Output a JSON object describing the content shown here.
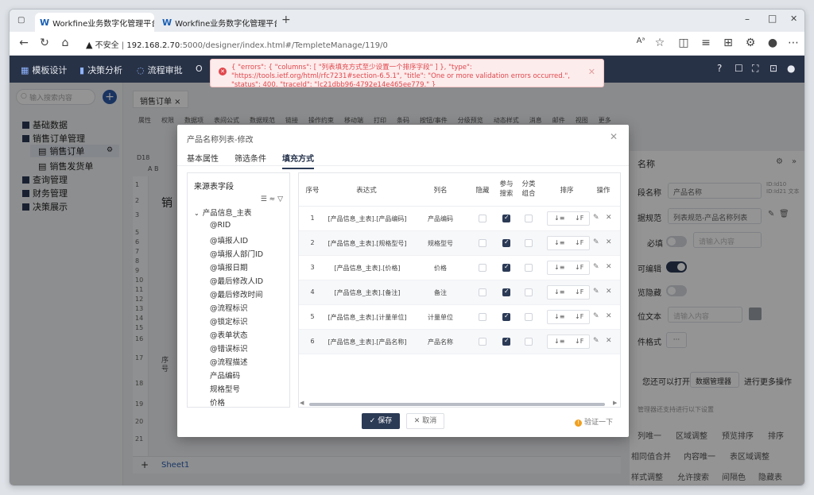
{
  "browser": {
    "tabs": [
      {
        "label": "Workfine业务数字化管理平台-II"
      },
      {
        "label": "Workfine业务数字化管理平台"
      }
    ],
    "new_tab": "+",
    "security_label": "不安全",
    "url_host": "192.168.2.70",
    "url_path": ":5000/designer/index.html#/TempleteManage/119/0",
    "window_controls": {
      "minimize": "–",
      "maximize": "□",
      "close": "✕"
    },
    "toolbar_icons": [
      "read-aloud-icon",
      "favorite-icon",
      "split-icon",
      "favorites-bar-icon",
      "collections-icon",
      "extensions-icon",
      "profile-icon",
      "more-icon"
    ]
  },
  "app": {
    "nav": [
      {
        "label": "模板设计"
      },
      {
        "label": "决策分析"
      },
      {
        "label": "流程审批"
      },
      {
        "label": "O"
      }
    ],
    "header_icons": [
      "?",
      "☐",
      "⛶",
      "⊡",
      "●"
    ]
  },
  "error_toast": {
    "message": "{ \"errors\": { \"columns\": [ \"列表填充方式至少设置一个排序字段\" ] }, \"type\": \"https://tools.ietf.org/html/rfc7231#section-6.5.1\", \"title\": \"One or more validation errors occurred.\", \"status\": 400, \"traceId\": \"|c21dbb96-4792e14e465ee779.\" }",
    "close": "✕"
  },
  "sidebar": {
    "search_placeholder": "输入搜索内容",
    "add": "+",
    "items": [
      {
        "label": "基础数据"
      },
      {
        "label": "销售订单管理"
      },
      {
        "label": "销售订单"
      },
      {
        "label": "销售发货单"
      },
      {
        "label": "查询管理"
      },
      {
        "label": "财务管理"
      },
      {
        "label": "决策展示"
      }
    ]
  },
  "workspace": {
    "page_tab": "销售订单 ×",
    "toolbar": [
      "属性",
      "权限",
      "数据项",
      "表间公式",
      "数据规范",
      "链接",
      "操作约束",
      "移动端",
      "打印",
      "条码",
      "按钮/事件",
      "分级预览",
      "动态样式",
      "消息",
      "邮件",
      "视图",
      "更多"
    ],
    "cell_ref": "D18",
    "col_labels": "A B",
    "row_numbers": [
      "1",
      "2",
      "3",
      "5",
      "6",
      "7",
      "8",
      "9",
      "10",
      "11",
      "12",
      "13",
      "14",
      "15",
      "16",
      "17",
      "18",
      "19",
      "20",
      "21"
    ],
    "cell_text_1": "销",
    "cell_text_2": "序号",
    "sheet_add": "+",
    "sheet_name": "Sheet1"
  },
  "right_panel": {
    "header": "名称",
    "field_name_label": "段名称",
    "field_name_value": "产品名称",
    "field_meta": "ID:Id10 ID:Id21 文本",
    "data_rule_label": "据规范",
    "data_rule_value": "列表规范-产品名称列表",
    "required_label": "必填",
    "required_placeholder": "请输入内容",
    "editable_label": "可编辑",
    "hidden_label": "览隐藏",
    "tip_label": "位文本",
    "tip_placeholder": "请输入内容",
    "format_label": "件格式",
    "format_btn": "···",
    "open_prompt": "您还可以打开",
    "data_manager": "数据管理器",
    "more_ops": "进行更多操作",
    "hint": "管理器还支持进行以下设置",
    "links": [
      "列唯一",
      "区域调整",
      "预览排序",
      "排序",
      "相同值合并",
      "内容唯一",
      "表区域调整",
      "样式调整",
      "允许搜索",
      "间隔色",
      "隐藏表"
    ]
  },
  "modal": {
    "title": "产品名称列表-修改",
    "close": "✕",
    "tabs": [
      {
        "label": "基本属性"
      },
      {
        "label": "筛选条件"
      },
      {
        "label": "填充方式"
      }
    ],
    "source": {
      "title": "来源表字段",
      "tools": "☰ ≈ ▽",
      "group": "产品信息_主表",
      "fields": [
        "@RID",
        "@填报人ID",
        "@填报人部门ID",
        "@填报日期",
        "@最后修改人ID",
        "@最后修改时间",
        "@流程标识",
        "@锁定标识",
        "@表单状态",
        "@错误标识",
        "@流程描述",
        "产品编码",
        "规格型号",
        "价格"
      ]
    },
    "grid": {
      "headers": {
        "seq": "序号",
        "expr": "表达式",
        "col": "列名",
        "hide": "隐藏",
        "search": "参与搜索",
        "group": "分类组合",
        "sort": "排序",
        "ops": "操作"
      },
      "sort_asc": "↓≡",
      "sort_desc": "↓F",
      "rows": [
        {
          "seq": "1",
          "expr": "[产品信息_主表].[产品编码]",
          "col": "产品编码",
          "hide": false,
          "search": true,
          "group": false
        },
        {
          "seq": "2",
          "expr": "[产品信息_主表].[规格型号]",
          "col": "规格型号",
          "hide": false,
          "search": true,
          "group": false
        },
        {
          "seq": "3",
          "expr": "[产品信息_主表].[价格]",
          "col": "价格",
          "hide": false,
          "search": true,
          "group": false
        },
        {
          "seq": "4",
          "expr": "[产品信息_主表].[备注]",
          "col": "备注",
          "hide": false,
          "search": true,
          "group": false
        },
        {
          "seq": "5",
          "expr": "[产品信息_主表].[计量单位]",
          "col": "计量单位",
          "hide": false,
          "search": true,
          "group": false
        },
        {
          "seq": "6",
          "expr": "[产品信息_主表].[产品名称]",
          "col": "产品名称",
          "hide": false,
          "search": true,
          "group": false
        }
      ]
    },
    "save": "✓ 保存",
    "cancel": "✕ 取消",
    "verify": "验证一下",
    "verify_icon": "!"
  },
  "colors": {
    "app_header": "#283246",
    "accent": "#2b3a55",
    "error": "#e0474c",
    "warning": "#f0a020"
  }
}
